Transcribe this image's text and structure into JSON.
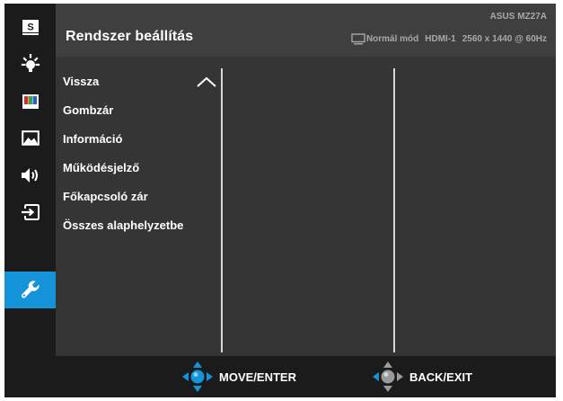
{
  "header": {
    "title": "Rendszer beállítás",
    "model": "ASUS MZ27A",
    "mode": "Normál mód",
    "input": "HDMI-1",
    "resolution": "2560 x 1440 @ 60Hz"
  },
  "sidebar": {
    "items": [
      {
        "name": "splendid",
        "icon": "splendid-s-icon",
        "active": false
      },
      {
        "name": "blue-light-filter",
        "icon": "bulb-icon",
        "active": false
      },
      {
        "name": "color",
        "icon": "color-bars-icon",
        "active": false
      },
      {
        "name": "image",
        "icon": "picture-icon",
        "active": false
      },
      {
        "name": "sound",
        "icon": "speaker-icon",
        "active": false
      },
      {
        "name": "input-select",
        "icon": "input-icon",
        "active": false
      },
      {
        "name": "system-setup",
        "icon": "wrench-icon",
        "active": true
      }
    ]
  },
  "menu": {
    "items": [
      "Vissza",
      "Gombzár",
      "Információ",
      "Működésjelző",
      "Főkapcsoló zár",
      "Összes alaphelyzetbe"
    ]
  },
  "footer": {
    "move_label": "MOVE/ENTER",
    "back_label": "BACK/EXIT"
  },
  "colors": {
    "accent": "#1593d9",
    "background": "#3f3f3f",
    "sidebar": "#1b1b1b",
    "text": "#ffffff",
    "muted_text": "#a8a8a8"
  }
}
